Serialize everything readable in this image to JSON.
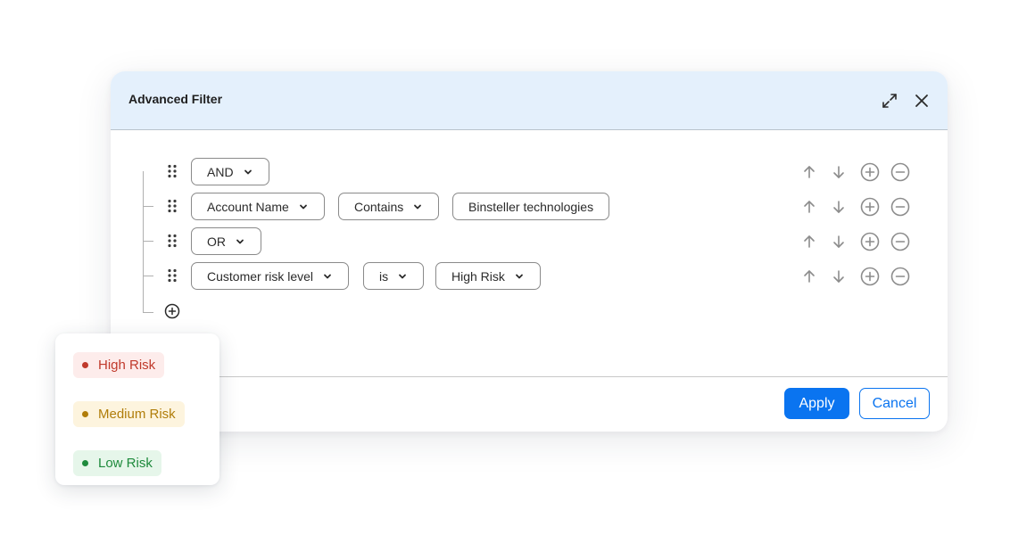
{
  "dialog": {
    "title": "Advanced Filter"
  },
  "icons": {
    "expand": "expand-icon",
    "close": "close-icon",
    "drag": "drag-handle-icon",
    "chevron": "chevron-down-icon",
    "move_up": "arrow-up-icon",
    "move_down": "arrow-down-icon",
    "add": "plus-circle-icon",
    "remove": "minus-circle-icon"
  },
  "rows": [
    {
      "type": "operator",
      "operator": "AND"
    },
    {
      "type": "condition",
      "field": "Account Name",
      "comparator": "Contains",
      "value": "Binsteller technologies"
    },
    {
      "type": "operator",
      "operator": "OR"
    },
    {
      "type": "condition",
      "field": "Customer risk level",
      "comparator": "is",
      "value": "High Risk"
    }
  ],
  "footer": {
    "apply_label": "Apply",
    "cancel_label": "Cancel"
  },
  "risk_dropdown": {
    "options": [
      {
        "label": "High Risk",
        "color": "#c0392b",
        "bg": "#fdeceb"
      },
      {
        "label": "Medium Risk",
        "color": "#b07d0a",
        "bg": "#fdf4de"
      },
      {
        "label": "Low Risk",
        "color": "#1e8a3c",
        "bg": "#e6f6ea"
      }
    ]
  },
  "colors": {
    "header_bg": "#e4f0fc",
    "primary": "#0a74f0",
    "icon_gray": "#8c8c8c"
  }
}
